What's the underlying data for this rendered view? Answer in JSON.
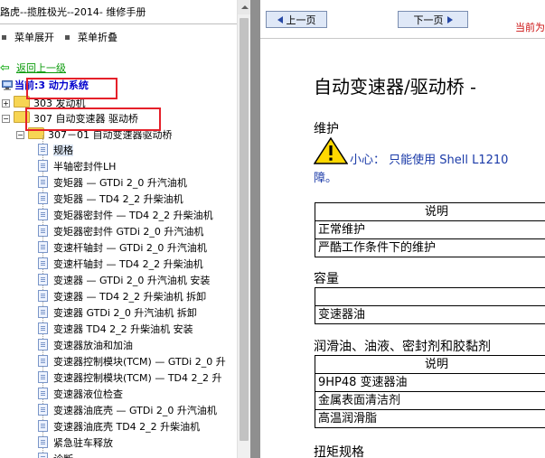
{
  "left": {
    "title": "路虎--揽胜极光--2014- 维修手册",
    "expand_label": "菜单展开",
    "collapse_label": "菜单折叠",
    "back_label": "返回上一级",
    "current_label": "当前:3 动力系统",
    "tree": {
      "node_303": "303 发动机",
      "node_307": "307 自动变速器 驱动桥",
      "node_307_01": "307－01 自动变速器驱动桥"
    },
    "items": [
      "规格",
      "半轴密封件LH",
      "变矩器 — GTDi 2_0 升汽油机",
      "变矩器 — TD4 2_2 升柴油机",
      "变矩器密封件 — TD4 2_2 升柴油机",
      "变矩器密封件 GTDi 2_0 升汽油机",
      "变速杆轴封 — GTDi 2_0 升汽油机",
      "变速杆轴封 — TD4 2_2 升柴油机",
      "变速器 — GTDi 2_0 升汽油机 安装",
      "变速器 — TD4 2_2 升柴油机 拆卸",
      "变速器 GTDi 2_0 升汽油机 拆卸",
      "变速器 TD4 2_2 升柴油机 安装",
      "变速器放油和加油",
      "变速器控制模块(TCM) — GTDi 2_0 升",
      "变速器控制模块(TCM) — TD4 2_2 升",
      "变速器液位检查",
      "变速器油底壳 — GTDi 2_0 升汽油机",
      "变速器油底壳 TD4 2_2 升柴油机",
      "紧急驻车释放",
      "诊断"
    ],
    "selected_index": 0,
    "highlight_color": "#e5202a"
  },
  "toolbar": {
    "prev_label": "上一页",
    "next_label": "下一页",
    "current_tag": "当前为"
  },
  "content": {
    "title": "自动变速器/驱动桥 -",
    "section_maintenance": "维护",
    "caution_prefix": "小心：",
    "caution_text": " 只能使用 ",
    "caution_oil": "Shell L1210",
    "caution_cont": "障。",
    "maint_table": {
      "header": "说明",
      "rows": [
        "正常维护",
        "严酷工作条件下的维护"
      ]
    },
    "section_capacity": "容量",
    "capacity_table": {
      "rows": [
        "",
        "变速器油"
      ]
    },
    "section_lube": "润滑油、油液、密封剂和胶黏剂",
    "lube_table": {
      "header": "说明",
      "rows": [
        "9HP48 变速器油",
        "金属表面清洁剂",
        "高温润滑脂"
      ]
    },
    "section_torque": "扭矩规格"
  }
}
